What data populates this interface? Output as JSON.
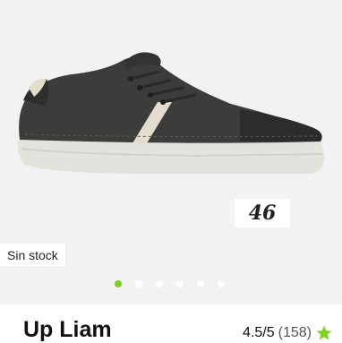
{
  "gallery": {
    "size_badge": "46",
    "stock_label": "Sin stock",
    "dots_count": 6,
    "active_dot": 0,
    "accent_color": "#7ed321"
  },
  "product": {
    "name": "Up Liam",
    "rating": "4.5/5",
    "reviews": "(158)",
    "star_icon": "star-icon"
  }
}
